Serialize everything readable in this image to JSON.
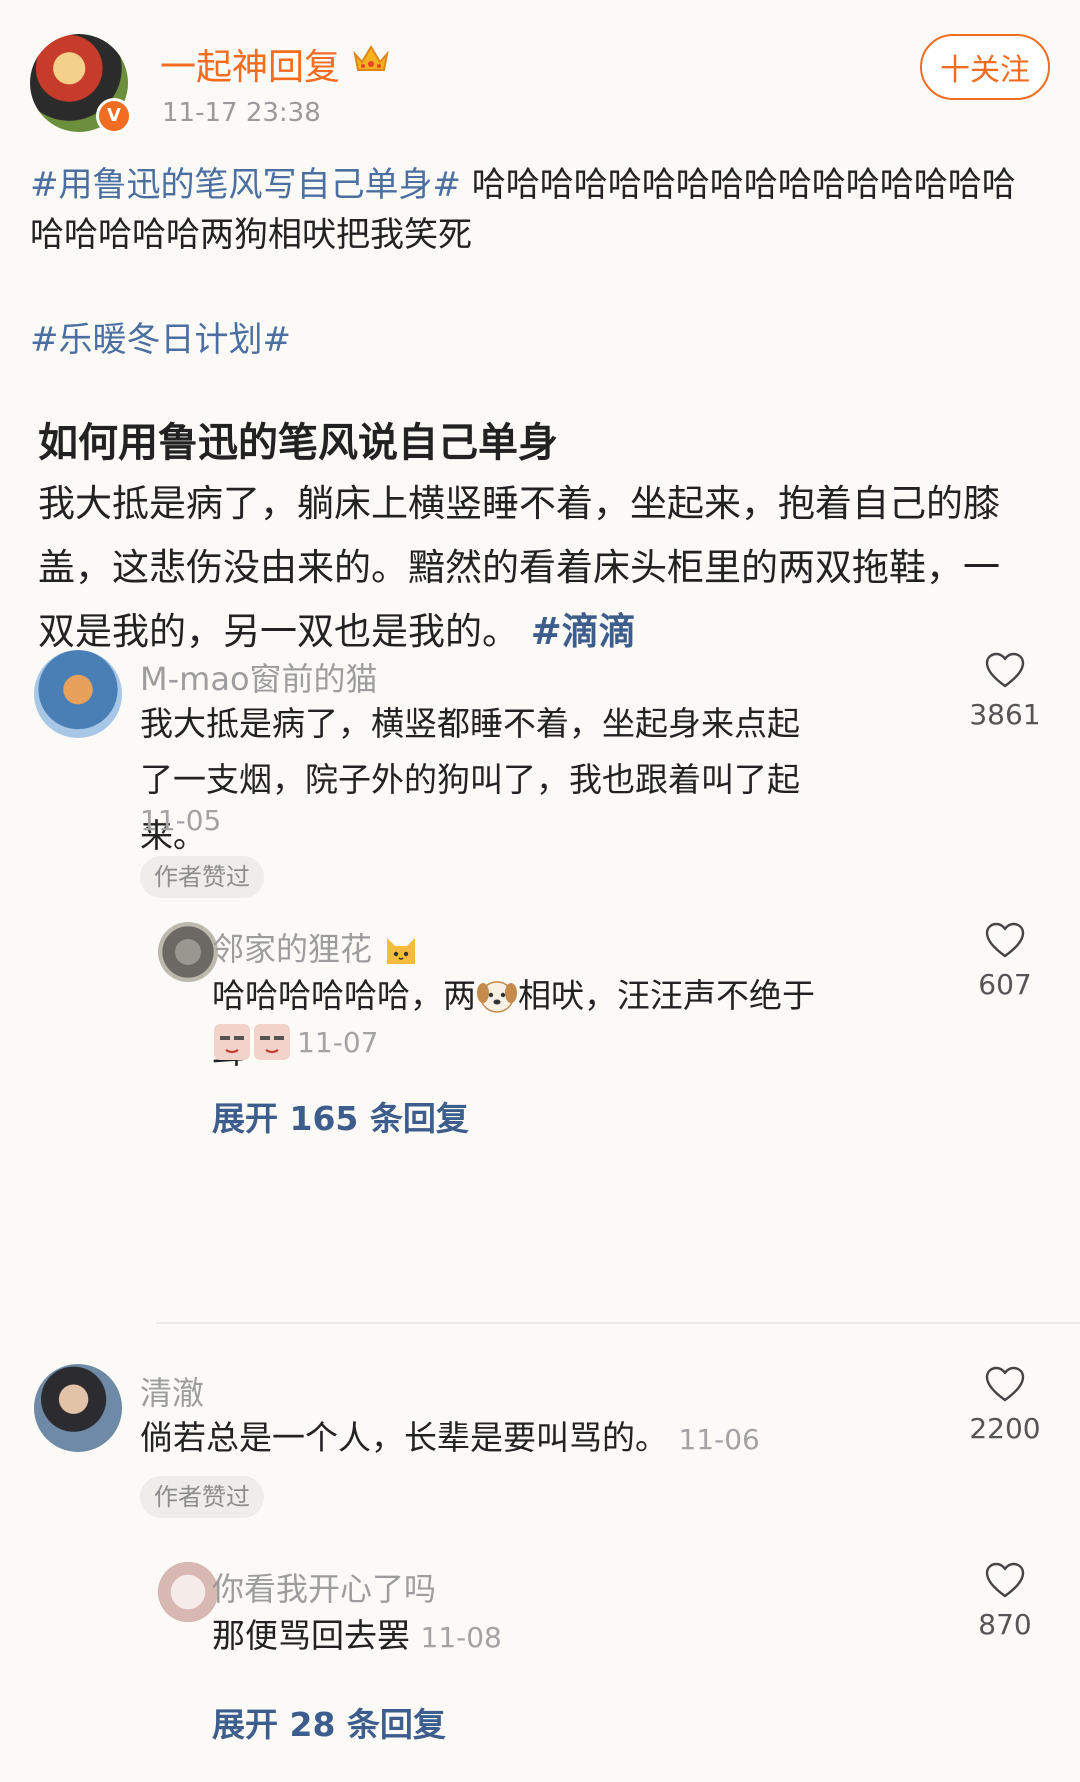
{
  "post": {
    "author": "一起神回复",
    "verified_badge": "V",
    "time": "11-17 23:38",
    "follow_label": "十关注",
    "hashtag1": "#用鲁迅的笔风写自己单身#",
    "text1": " 哈哈哈哈哈哈哈哈哈哈哈哈哈哈哈哈哈哈哈哈哈两狗相吠把我笑死",
    "hashtag2": "#乐暖冬日计划#",
    "quote_title": "如何用鲁迅的笔风说自己单身",
    "quote_body": "我大抵是病了，躺床上横竖睡不着，坐起来，抱着自己的膝盖，这悲伤没由来的。黯然的看着床头柜里的两双拖鞋，一双是我的，另一双也是我的。",
    "quote_hashtag": "#滴滴"
  },
  "comments": [
    {
      "user": "M-mao窗前的猫",
      "text": "我大抵是病了，横竖都睡不着，坐起身来点起了一支烟，院子外的狗叫了，我也跟着叫了起来。",
      "date": "11-05",
      "likes": "3861",
      "author_liked": "作者赞过",
      "reply": {
        "user": "邻家的狸花",
        "text_a": "哈哈哈哈哈哈，两",
        "text_b": "相吠，汪汪声不绝于耳",
        "date": "11-07",
        "likes": "607"
      },
      "expand": "展开 165 条回复"
    },
    {
      "user": "清澈",
      "text": "倘若总是一个人，长辈是要叫骂的。",
      "date": "11-06",
      "likes": "2200",
      "author_liked": "作者赞过",
      "reply": {
        "user": "你看我开心了吗",
        "text": "那便骂回去罢",
        "date": "11-08",
        "likes": "870"
      },
      "expand": "展开 28 条回复"
    }
  ],
  "colors": {
    "accent_orange": "#f26d22",
    "link_blue": "#3d5e8c",
    "muted": "#9d9d9d"
  },
  "icons": [
    "crown-icon",
    "plus-icon",
    "heart-icon",
    "dog-emoji-icon",
    "cat-emoji-icon"
  ]
}
